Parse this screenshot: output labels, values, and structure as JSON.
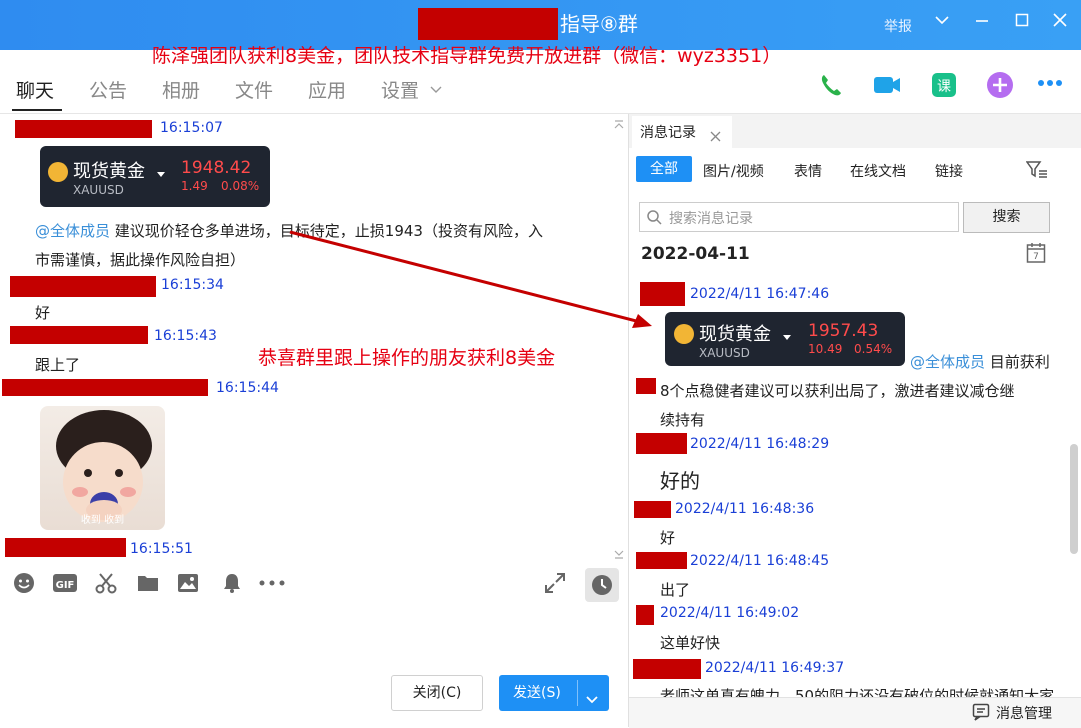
{
  "window": {
    "title": "指导⑧群",
    "report": "举报",
    "promo": "陈泽强团队获利8美金，团队技术指导群免费开放进群（微信：wyz3351）"
  },
  "tabs": [
    "聊天",
    "公告",
    "相册",
    "文件",
    "应用",
    "设置"
  ],
  "chat": {
    "m1": {
      "time": "16:15:07"
    },
    "stock1": {
      "name": "现货黄金",
      "symbol": "XAUUSD",
      "price": "1948.42",
      "change": "1.49",
      "pct": "0.08%"
    },
    "m2": {
      "at": "@全体成员",
      "line1": "建议现价轻仓多单进场，目标待定，止损1943（投资有风险，入",
      "line2": "市需谨慎，据此操作风险自担）"
    },
    "m3": {
      "time": "16:15:34",
      "text": "好"
    },
    "m4": {
      "time": "16:15:43",
      "text": "跟上了"
    },
    "m5": {
      "time": "16:15:44",
      "sticker_caption": "收到 收到"
    },
    "m6": {
      "time": "16:15:51"
    },
    "annotation": "恭喜群里跟上操作的朋友获利8美金"
  },
  "actions": {
    "close": "关闭(C)",
    "send": "发送(S)"
  },
  "history": {
    "tab": "消息记录",
    "filters": [
      "全部",
      "图片/视频",
      "表情",
      "在线文档",
      "链接"
    ],
    "search_placeholder": "搜索消息记录",
    "search_btn": "搜索",
    "date": "2022-04-11",
    "h1": {
      "time": "2022/4/11 16:47:46"
    },
    "stock2": {
      "name": "现货黄金",
      "symbol": "XAUUSD",
      "price": "1957.43",
      "change": "10.49",
      "pct": "0.54%"
    },
    "h2": {
      "at": "@全体成员",
      "tail": "目前获利",
      "line2": "8个点稳健者建议可以获利出局了，激进者建议减仓继",
      "line3": "续持有"
    },
    "h3": {
      "time": "2022/4/11 16:48:29",
      "text": "好的"
    },
    "h4": {
      "time": "2022/4/11 16:48:36",
      "text": "好"
    },
    "h5": {
      "time": "2022/4/11 16:48:45",
      "text": "出了"
    },
    "h6": {
      "time": "2022/4/11 16:49:02",
      "text": "这单好快"
    },
    "h7": {
      "time": "2022/4/11 16:49:37",
      "text": "老师这单真有魄力，50的阻力还没有破位的时候就通知大家"
    },
    "manage": "消息管理"
  }
}
